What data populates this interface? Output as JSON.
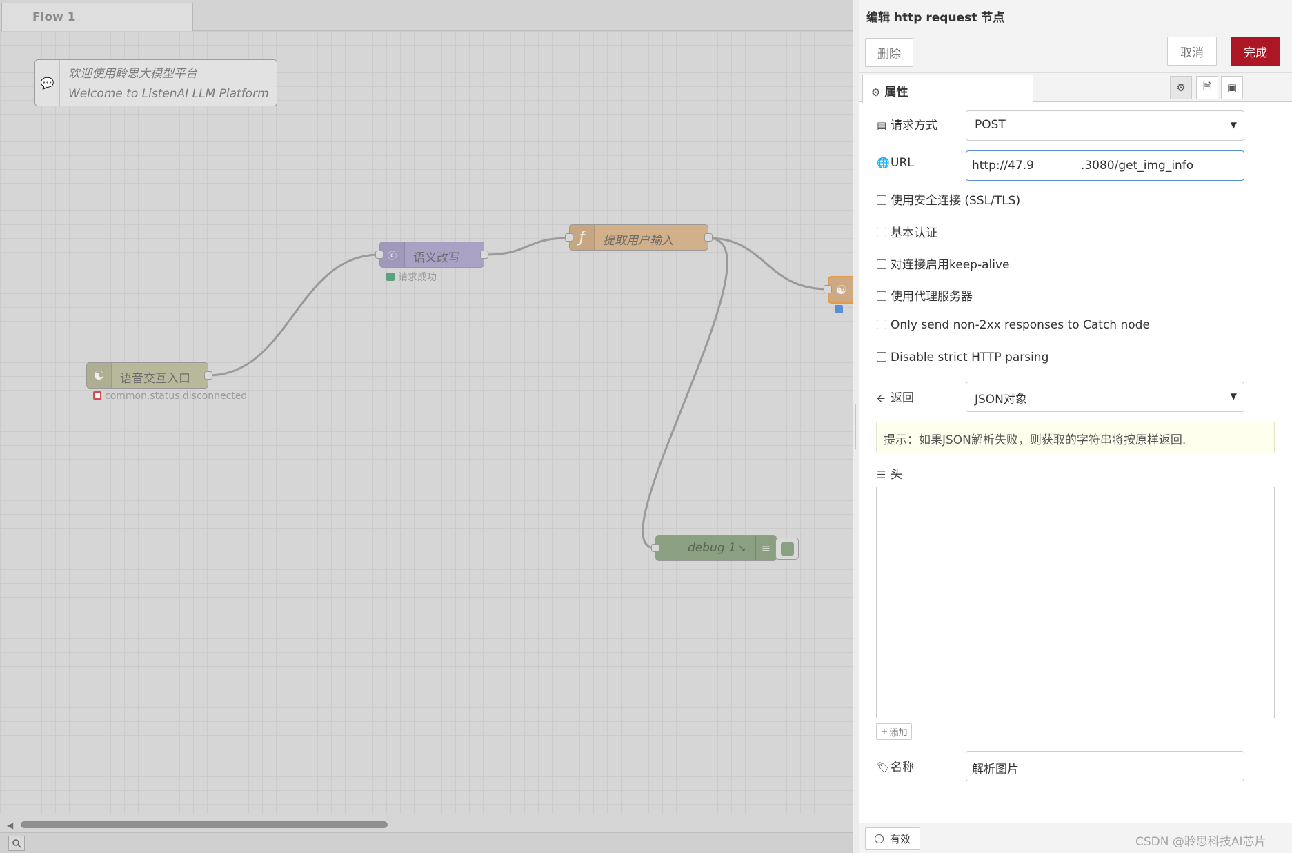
{
  "workspace": {
    "flow_tab": "Flow 1",
    "comment": {
      "line1": "欢迎使用聆思大模型平台",
      "line2": "Welcome to ListenAI LLM Platform"
    },
    "nodes": {
      "voice_entry": {
        "label": "语音交互入口",
        "status": "common.status.disconnected",
        "status_color": "#d24e4e"
      },
      "rewrite": {
        "label": "语义改写",
        "status": "请求成功",
        "status_color": "#5aa37f"
      },
      "extract": {
        "label": "提取用户输入",
        "icon": "function-icon"
      },
      "debug": {
        "label": "debug 1"
      }
    }
  },
  "panel": {
    "title": "编辑 http request 节点",
    "buttons": {
      "delete": "删除",
      "cancel": "取消",
      "done": "完成"
    },
    "tabs": {
      "properties": "属性"
    },
    "fields": {
      "method_label": "请求方式",
      "method_value": "POST",
      "url_label": "URL",
      "url_value": "http://47.9        .3080/get_img_info",
      "checkboxes": [
        "使用安全连接 (SSL/TLS)",
        "基本认证",
        "对连接启用keep-alive",
        "使用代理服务器",
        "Only send non-2xx responses to Catch node",
        "Disable strict HTTP parsing"
      ],
      "return_label": "返回",
      "return_value": "JSON对象",
      "tip": "提示：如果JSON解析失败，则获取的字符串将按原样返回.",
      "headers_label": "头",
      "add_button": "添加",
      "name_label": "名称",
      "name_value": "解析图片"
    },
    "footer": {
      "enabled": "有效",
      "watermark": "CSDN @聆思科技AI芯片"
    }
  },
  "colors": {
    "accent_done": "#ad1625",
    "url_focus": "#5a8fd6",
    "tip_bg": "#ffffee"
  }
}
